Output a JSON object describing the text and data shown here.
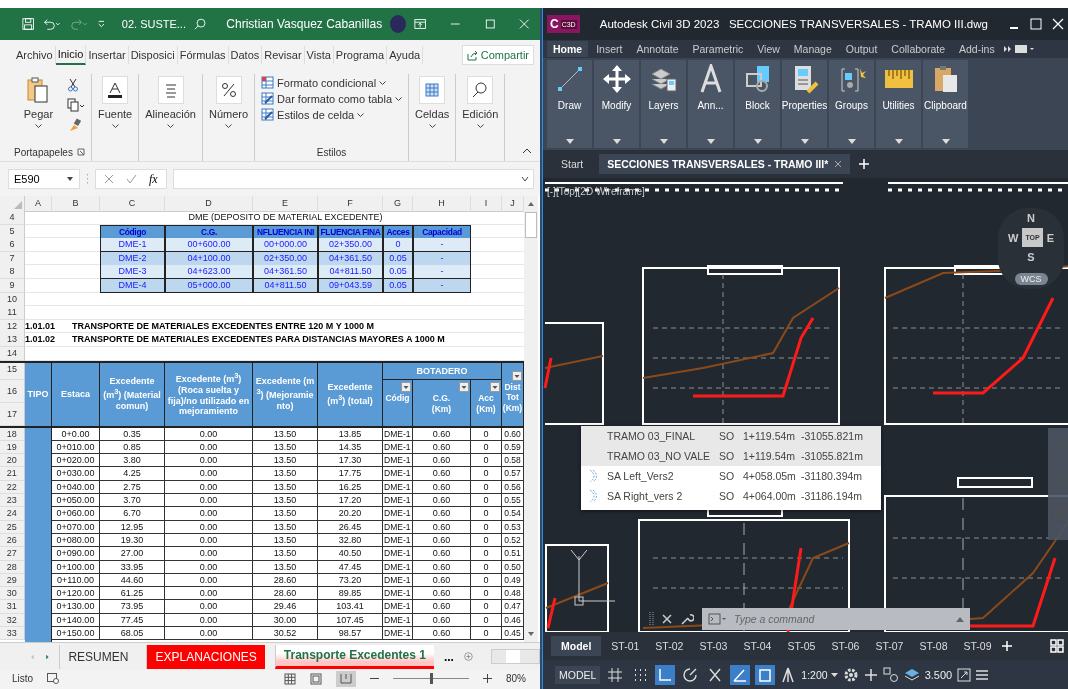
{
  "excel": {
    "title_bar": {
      "file_name": "02. SUSTE...",
      "user": "Christian Vasquez Cabanillas"
    },
    "tabs": [
      {
        "label": "Archivo",
        "selected": false
      },
      {
        "label": "Inicio",
        "selected": true
      },
      {
        "label": "Insertar",
        "selected": false
      },
      {
        "label": "Disposici",
        "selected": false
      },
      {
        "label": "Fórmulas",
        "selected": false
      },
      {
        "label": "Datos",
        "selected": false
      },
      {
        "label": "Revisar",
        "selected": false
      },
      {
        "label": "Vista",
        "selected": false
      },
      {
        "label": "Programa",
        "selected": false
      },
      {
        "label": "Ayuda",
        "selected": false
      }
    ],
    "share_button": "Compartir",
    "ribbon": {
      "paste": "Pegar",
      "clipboard_group": "Portapapeles",
      "buttons": [
        {
          "label": "Fuente",
          "kind": "font"
        },
        {
          "label": "Alineación",
          "kind": "align"
        },
        {
          "label": "Número",
          "kind": "percent"
        }
      ],
      "styles": [
        "Formato condicional",
        "Dar formato como tabla",
        "Estilos de celda"
      ],
      "styles_group": "Estilos",
      "more_buttons": [
        {
          "label": "Celdas",
          "kind": "cells"
        },
        {
          "label": "Edición",
          "kind": "search"
        }
      ]
    },
    "name_box": "E590",
    "formula_label": "fx",
    "columns": [
      "A",
      "B",
      "C",
      "D",
      "E",
      "F",
      "G",
      "H",
      "I",
      "J"
    ],
    "upper_rows": [
      {
        "num": "4",
        "kind": "title",
        "text": "DME (DEPOSITO DE MATERIAL EXCEDENTE)"
      },
      {
        "num": "5",
        "kind": "dme_header",
        "cells": [
          "Código",
          "C.G.",
          "NFLUENCIA INI",
          "FLUENCIA FINA",
          "Acces",
          "Capacidad"
        ]
      },
      {
        "num": "6",
        "kind": "dme_row",
        "cells": [
          "DME-1",
          "00+600.00",
          "00+000.00",
          "02+350.00",
          "0",
          "-"
        ]
      },
      {
        "num": "7",
        "kind": "dme_row",
        "cells": [
          "DME-2",
          "04+100.00",
          "02+350.00",
          "04+361.50",
          "0.05",
          "-"
        ]
      },
      {
        "num": "8",
        "kind": "dme_row",
        "cells": [
          "DME-3",
          "04+623.00",
          "04+361.50",
          "04+811.50",
          "0.05",
          "-"
        ]
      },
      {
        "num": "9",
        "kind": "dme_row",
        "cells": [
          "DME-4",
          "05+000.00",
          "04+811.50",
          "09+043.59",
          "0.05",
          "-"
        ]
      },
      {
        "num": "10",
        "kind": "blank"
      },
      {
        "num": "11",
        "kind": "blank"
      },
      {
        "num": "12",
        "kind": "item",
        "code": "1.01.01",
        "text": "TRANSPORTE DE MATERIALES EXCEDENTES ENTRE 120 M Y 1000 M"
      },
      {
        "num": "13",
        "kind": "item",
        "code": "1.01.02",
        "text": "TRANSPORTE DE MATERIALES EXCEDENTES PARA DISTANCIAS MAYORES A 1000 M"
      },
      {
        "num": "14",
        "kind": "blank"
      }
    ],
    "main_header": {
      "rows": [
        "15",
        "16",
        "17"
      ],
      "tipo": "TIPO",
      "estaca": "Estaca",
      "excedentes": [
        "Excedente (m$^{3}$) (Material comun)",
        "Excedente (m$^{3}$) (Roca suelta y fija)/no utilizado en mejoramiento",
        "Excedente (m$^{3}$) (Mejoramiento)",
        "Excedente (m$^{3}$) (total)"
      ],
      "group": "BOTADERO",
      "sub": [
        {
          "label": "Códig"
        },
        {
          "label": "C.G.",
          "unit": "(Km)"
        },
        {
          "label": "Acc",
          "unit": "(Km)"
        }
      ],
      "dist": {
        "label": "Dist Tot",
        "unit": "(Km)"
      }
    },
    "data_rows": [
      {
        "num": "18",
        "cells": [
          "0+0.00",
          "0.35",
          "0.00",
          "13.50",
          "13.85",
          "DME-1",
          "0.60",
          "0",
          "0.60"
        ]
      },
      {
        "num": "19",
        "cells": [
          "0+010.00",
          "0.85",
          "0.00",
          "13.50",
          "14.35",
          "DME-1",
          "0.60",
          "0",
          "0.59"
        ]
      },
      {
        "num": "20",
        "cells": [
          "0+020.00",
          "3.80",
          "0.00",
          "13.50",
          "17.30",
          "DME-1",
          "0.60",
          "0",
          "0.58"
        ]
      },
      {
        "num": "21",
        "cells": [
          "0+030.00",
          "4.25",
          "0.00",
          "13.50",
          "17.75",
          "DME-1",
          "0.60",
          "0",
          "0.57"
        ]
      },
      {
        "num": "22",
        "cells": [
          "0+040.00",
          "2.75",
          "0.00",
          "13.50",
          "16.25",
          "DME-1",
          "0.60",
          "0",
          "0.56"
        ]
      },
      {
        "num": "23",
        "cells": [
          "0+050.00",
          "3.70",
          "0.00",
          "13.50",
          "17.20",
          "DME-1",
          "0.60",
          "0",
          "0.55"
        ]
      },
      {
        "num": "24",
        "cells": [
          "0+060.00",
          "6.70",
          "0.00",
          "13.50",
          "20.20",
          "DME-1",
          "0.60",
          "0",
          "0.54"
        ]
      },
      {
        "num": "25",
        "cells": [
          "0+070.00",
          "12.95",
          "0.00",
          "13.50",
          "26.45",
          "DME-1",
          "0.60",
          "0",
          "0.53"
        ]
      },
      {
        "num": "26",
        "cells": [
          "0+080.00",
          "19.30",
          "0.00",
          "13.50",
          "32.80",
          "DME-1",
          "0.60",
          "0",
          "0.52"
        ]
      },
      {
        "num": "27",
        "cells": [
          "0+090.00",
          "27.00",
          "0.00",
          "13.50",
          "40.50",
          "DME-1",
          "0.60",
          "0",
          "0.51"
        ]
      },
      {
        "num": "28",
        "cells": [
          "0+100.00",
          "33.95",
          "0.00",
          "13.50",
          "47.45",
          "DME-1",
          "0.60",
          "0",
          "0.50"
        ]
      },
      {
        "num": "29",
        "cells": [
          "0+110.00",
          "44.60",
          "0.00",
          "28.60",
          "73.20",
          "DME-1",
          "0.60",
          "0",
          "0.49"
        ]
      },
      {
        "num": "30",
        "cells": [
          "0+120.00",
          "61.25",
          "0.00",
          "28.60",
          "89.85",
          "DME-1",
          "0.60",
          "0",
          "0.48"
        ]
      },
      {
        "num": "31",
        "cells": [
          "0+130.00",
          "73.95",
          "0.00",
          "29.46",
          "103.41",
          "DME-1",
          "0.60",
          "0",
          "0.47"
        ]
      },
      {
        "num": "32",
        "cells": [
          "0+140.00",
          "77.45",
          "0.00",
          "30.00",
          "107.45",
          "DME-1",
          "0.60",
          "0",
          "0.46"
        ]
      },
      {
        "num": "33",
        "cells": [
          "0+150.00",
          "68.05",
          "0.00",
          "30.52",
          "98.57",
          "DME-1",
          "0.60",
          "0",
          "0.45"
        ]
      }
    ],
    "sheet_tabs": [
      {
        "label": "RESUMEN",
        "selected": false
      },
      {
        "label": "EXPLANACIONES",
        "selected": false,
        "color": "#ff0000"
      },
      {
        "label": "Transporte Excedentes 1",
        "selected": true,
        "color": "#ff0000"
      }
    ],
    "more_tabs": "...",
    "status": "Listo",
    "zoom": {
      "level": 0.5,
      "label": "80%"
    }
  },
  "cad": {
    "app": "Autodesk Civil 3D 2023",
    "file": "SECCIONES TRANSVERSALES - TRAMO III.dwg",
    "logo": {
      "letter": "C",
      "badge": "C3D"
    },
    "tabs": [
      {
        "label": "Home",
        "selected": true
      },
      {
        "label": "Insert",
        "selected": false
      },
      {
        "label": "Annotate",
        "selected": false
      },
      {
        "label": "Parametric",
        "selected": false
      },
      {
        "label": "View",
        "selected": false
      },
      {
        "label": "Manage",
        "selected": false
      },
      {
        "label": "Output",
        "selected": false
      },
      {
        "label": "Collaborate",
        "selected": false
      },
      {
        "label": "Add-ins",
        "selected": false
      }
    ],
    "panels": [
      {
        "label": "Draw",
        "kind": "draw"
      },
      {
        "label": "Modify",
        "kind": "modify"
      },
      {
        "label": "Layers",
        "kind": "layers"
      },
      {
        "label": "Ann...",
        "kind": "annotate"
      },
      {
        "label": "Block",
        "kind": "block"
      },
      {
        "label": "Properties",
        "kind": "properties"
      },
      {
        "label": "Groups",
        "kind": "groups"
      },
      {
        "label": "Utilities",
        "kind": "utilities"
      },
      {
        "label": "Clipboard",
        "kind": "clipboard"
      }
    ],
    "doc_tabs": [
      {
        "label": "Start",
        "selected": false
      },
      {
        "label": "SECCIONES TRANSVERSALES - TRAMO III*",
        "selected": true
      }
    ],
    "viewport_label": "[-][Top][2D Wireframe]",
    "viewcube": {
      "north": "N",
      "west": "W",
      "east": "E",
      "south": "S",
      "face": "TOP",
      "ucs": "WCS"
    },
    "popup": [
      {
        "name": "TRAMO 03_FINAL",
        "code": "SO",
        "station": "1+119.54m",
        "offset": "-31055.821m",
        "highlighted": true,
        "kind": "plain"
      },
      {
        "name": "TRAMO 03_NO VALE",
        "code": "SO",
        "station": "1+119.54m",
        "offset": "-31055.821m",
        "highlighted": true,
        "kind": "plain"
      },
      {
        "name": "SA Left_Vers2",
        "code": "SO",
        "station": "4+058.05m",
        "offset": "-31180.394m",
        "highlighted": false,
        "kind": "alignment"
      },
      {
        "name": "SA Right_vers 2",
        "code": "SO",
        "station": "4+064.00m",
        "offset": "-31186.194m",
        "highlighted": false,
        "kind": "alignment"
      }
    ],
    "command_placeholder": "Type a command",
    "layout_tabs": [
      {
        "label": "Model",
        "selected": true
      },
      {
        "label": "ST-01",
        "selected": false
      },
      {
        "label": "ST-02",
        "selected": false
      },
      {
        "label": "ST-03",
        "selected": false
      },
      {
        "label": "ST-04",
        "selected": false
      },
      {
        "label": "ST-05",
        "selected": false
      },
      {
        "label": "ST-06",
        "selected": false
      },
      {
        "label": "ST-07",
        "selected": false
      },
      {
        "label": "ST-08",
        "selected": false
      },
      {
        "label": "ST-09",
        "selected": false
      }
    ],
    "status": {
      "mode": "MODEL",
      "scale": "1:200",
      "value": "3.500",
      "toggles": [
        {
          "kind": "grid",
          "on": false
        },
        {
          "kind": "snap",
          "on": false
        },
        {
          "kind": "ortho",
          "on": true
        },
        {
          "kind": "polar",
          "on": false
        },
        {
          "kind": "osnap",
          "on": false
        },
        {
          "kind": "angle",
          "on": true
        },
        {
          "kind": "frame",
          "on": true
        }
      ]
    }
  }
}
